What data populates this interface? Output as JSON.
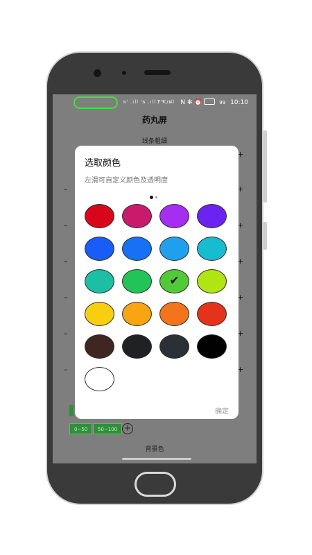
{
  "status_bar": {
    "signals": "ᵴᴵ .ıll ᴵᵴ .ıll ⁴ᴳ .ıll",
    "speed": "1 K/s",
    "icons": "N ✻ ⏰",
    "battery": "99",
    "time": "10:10"
  },
  "app": {
    "title": "药丸屏",
    "sections": {
      "line_thickness": "线条粗细",
      "background_color": "背景色"
    },
    "chips": [
      "0~50",
      "50~100"
    ]
  },
  "dialog": {
    "title": "选取颜色",
    "subtitle": "左滑可自定义颜色及透明度",
    "page_dots": {
      "count": 2,
      "active": 0
    },
    "confirm": "确定",
    "swatches": [
      {
        "name": "red",
        "color": "#d8051b",
        "selected": false
      },
      {
        "name": "pink",
        "color": "#c91a6c",
        "selected": false
      },
      {
        "name": "purple",
        "color": "#a52ef0",
        "selected": false
      },
      {
        "name": "deep-purple",
        "color": "#6b23f2",
        "selected": false
      },
      {
        "name": "blue",
        "color": "#1a5cf7",
        "selected": false
      },
      {
        "name": "light-blue",
        "color": "#1671f6",
        "selected": false
      },
      {
        "name": "sky-blue",
        "color": "#1ea0ee",
        "selected": false
      },
      {
        "name": "cyan",
        "color": "#17bcce",
        "selected": false
      },
      {
        "name": "teal",
        "color": "#1cbfa4",
        "selected": false
      },
      {
        "name": "green",
        "color": "#22c45a",
        "selected": false
      },
      {
        "name": "light-green",
        "color": "#52c936",
        "selected": true
      },
      {
        "name": "lime",
        "color": "#b0e412",
        "selected": false
      },
      {
        "name": "yellow",
        "color": "#f8cf10",
        "selected": false
      },
      {
        "name": "amber",
        "color": "#f8a413",
        "selected": false
      },
      {
        "name": "orange",
        "color": "#f3741a",
        "selected": false
      },
      {
        "name": "deep-orange",
        "color": "#e3331b",
        "selected": false
      },
      {
        "name": "brown",
        "color": "#3f2622",
        "selected": false
      },
      {
        "name": "charcoal",
        "color": "#202122",
        "selected": false
      },
      {
        "name": "slate",
        "color": "#2a3036",
        "selected": false
      },
      {
        "name": "black",
        "color": "#020202",
        "selected": false
      },
      {
        "name": "white",
        "color": "#ffffff",
        "selected": false
      }
    ],
    "check_icon": "✔"
  },
  "colors": {
    "overlay": "#7e7e7e",
    "phone_body": "#3a3a3a",
    "accent_green": "#4ade3a"
  }
}
